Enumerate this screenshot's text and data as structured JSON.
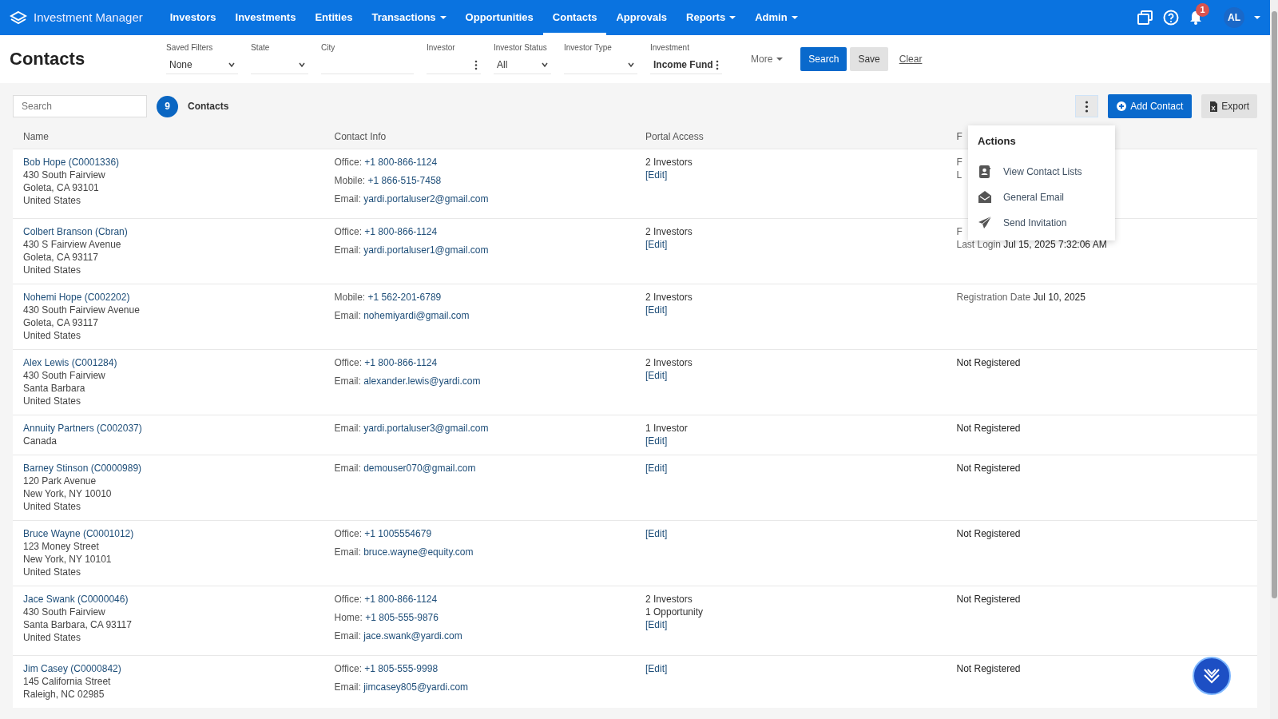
{
  "app": {
    "name": "Investment Manager"
  },
  "nav": [
    {
      "label": "Investors",
      "selected": false,
      "dropdown": false
    },
    {
      "label": "Investments",
      "selected": false,
      "dropdown": false
    },
    {
      "label": "Entities",
      "selected": false,
      "dropdown": false
    },
    {
      "label": "Transactions",
      "selected": false,
      "dropdown": true
    },
    {
      "label": "Opportunities",
      "selected": false,
      "dropdown": false
    },
    {
      "label": "Contacts",
      "selected": true,
      "dropdown": false
    },
    {
      "label": "Approvals",
      "selected": false,
      "dropdown": false
    },
    {
      "label": "Reports",
      "selected": false,
      "dropdown": true
    },
    {
      "label": "Admin",
      "selected": false,
      "dropdown": true
    }
  ],
  "user": {
    "notifications": "1",
    "initials": "AL"
  },
  "page_title": "Contacts",
  "filters": [
    {
      "label": "Saved Filters",
      "value": "None",
      "kind": "select"
    },
    {
      "label": "State",
      "kind": "select"
    },
    {
      "label": "City",
      "kind": "text"
    },
    {
      "label": "Investor",
      "kind": "picker"
    },
    {
      "label": "Investor Status",
      "value": "All",
      "kind": "select"
    },
    {
      "label": "Investor Type",
      "kind": "select"
    },
    {
      "label": "Investment",
      "value": "Income Fund",
      "kind": "picker"
    }
  ],
  "filter_actions": {
    "more": "More",
    "search": "Search",
    "save": "Save",
    "clear": "Clear"
  },
  "toolbar": {
    "search_placeholder": "Search",
    "count": "9",
    "count_label": "Contacts",
    "add": "Add Contact",
    "export": "Export"
  },
  "actions_menu": {
    "title": "Actions",
    "items": [
      {
        "label": "View Contact Lists",
        "kind": "list"
      },
      {
        "label": "General Email",
        "kind": "email"
      },
      {
        "label": "Send Invitation",
        "kind": "send"
      }
    ]
  },
  "table": {
    "columns": [
      "Name",
      "Contact Info",
      "Portal Access",
      "F"
    ],
    "rows": [
      {
        "name": "Bob Hope (C0001336)",
        "address": [
          "430 South Fairview",
          "Goleta, CA 93101",
          "United States"
        ],
        "contact": [
          {
            "label": "Office:",
            "value": "+1 800-866-1124"
          },
          {
            "label": "Mobile:",
            "value": "+1 866-515-7458"
          },
          {
            "label": "Email:",
            "value": "yardi.portaluser2@gmail.com"
          }
        ],
        "portal": [
          "2 Investors"
        ],
        "edit": "[Edit]",
        "status": [
          {
            "label": "F"
          },
          {
            "label": "L"
          }
        ]
      },
      {
        "name": "Colbert Branson (Cbran)",
        "address": [
          "430 S Fairview Avenue",
          "Goleta, CA 93117",
          "United States"
        ],
        "contact": [
          {
            "label": "Office:",
            "value": "+1 800-866-1124"
          },
          {
            "label": "Email:",
            "value": "yardi.portaluser1@gmail.com"
          }
        ],
        "portal": [
          "2 Investors"
        ],
        "edit": "[Edit]",
        "status": [
          {
            "label": "F"
          },
          {
            "label": "Last Login",
            "value": "Jul 15, 2025 7:32:06 AM"
          }
        ]
      },
      {
        "name": "Nohemi Hope (C002202)",
        "address": [
          "430 South Fairview Avenue",
          "Goleta, CA 93117",
          "United States"
        ],
        "contact": [
          {
            "label": "Mobile:",
            "value": "+1 562-201-6789"
          },
          {
            "label": "Email:",
            "value": "nohemiyardi@gmail.com"
          }
        ],
        "portal": [
          "2 Investors"
        ],
        "edit": "[Edit]",
        "status": [
          {
            "label": "Registration Date",
            "value": "Jul 10, 2025"
          }
        ]
      },
      {
        "name": "Alex Lewis (C001284)",
        "address": [
          "430 South Fairview",
          "Santa Barbara",
          "United States"
        ],
        "contact": [
          {
            "label": "Office:",
            "value": "+1 800-866-1124"
          },
          {
            "label": "Email:",
            "value": "alexander.lewis@yardi.com"
          }
        ],
        "portal": [
          "2 Investors"
        ],
        "edit": "[Edit]",
        "status": [
          {
            "value": "Not Registered"
          }
        ]
      },
      {
        "name": "Annuity Partners (C002037)",
        "address": [
          "Canada"
        ],
        "contact": [
          {
            "label": "Email:",
            "value": "yardi.portaluser3@gmail.com"
          }
        ],
        "portal": [
          "1 Investor"
        ],
        "edit": "[Edit]",
        "status": [
          {
            "value": "Not Registered"
          }
        ]
      },
      {
        "name": "Barney Stinson (C0000989)",
        "address": [
          "120 Park Avenue",
          "New York, NY 10010",
          "United States"
        ],
        "contact": [
          {
            "label": "Email:",
            "value": "demouser070@gmail.com"
          }
        ],
        "edit": "[Edit]",
        "status": [
          {
            "value": "Not Registered"
          }
        ]
      },
      {
        "name": "Bruce Wayne (C0001012)",
        "address": [
          "123 Money Street",
          "New York, NY 10101",
          "United States"
        ],
        "contact": [
          {
            "label": "Office:",
            "value": "+1 1005554679"
          },
          {
            "label": "Email:",
            "value": "bruce.wayne@equity.com"
          }
        ],
        "edit": "[Edit]",
        "status": [
          {
            "value": "Not Registered"
          }
        ]
      },
      {
        "name": "Jace Swank (C0000046)",
        "address": [
          "430 South Fairview",
          "Santa Barbara, CA 93117",
          "United States"
        ],
        "contact": [
          {
            "label": "Office:",
            "value": "+1 800-866-1124"
          },
          {
            "label": "Home:",
            "value": "+1 805-555-9876"
          },
          {
            "label": "Email:",
            "value": "jace.swank@yardi.com"
          }
        ],
        "portal": [
          "2 Investors",
          "1 Opportunity"
        ],
        "edit": "[Edit]",
        "status": [
          {
            "value": "Not Registered"
          }
        ]
      },
      {
        "name": "Jim Casey (C0000842)",
        "address": [
          "145 California Street",
          "Raleigh, NC 02985"
        ],
        "contact": [
          {
            "label": "Office:",
            "value": "+1 805-555-9998"
          },
          {
            "label": "Email:",
            "value": "jimcasey805@yardi.com"
          }
        ],
        "edit": "[Edit]",
        "status": [
          {
            "value": "Not Registered"
          }
        ]
      }
    ]
  }
}
